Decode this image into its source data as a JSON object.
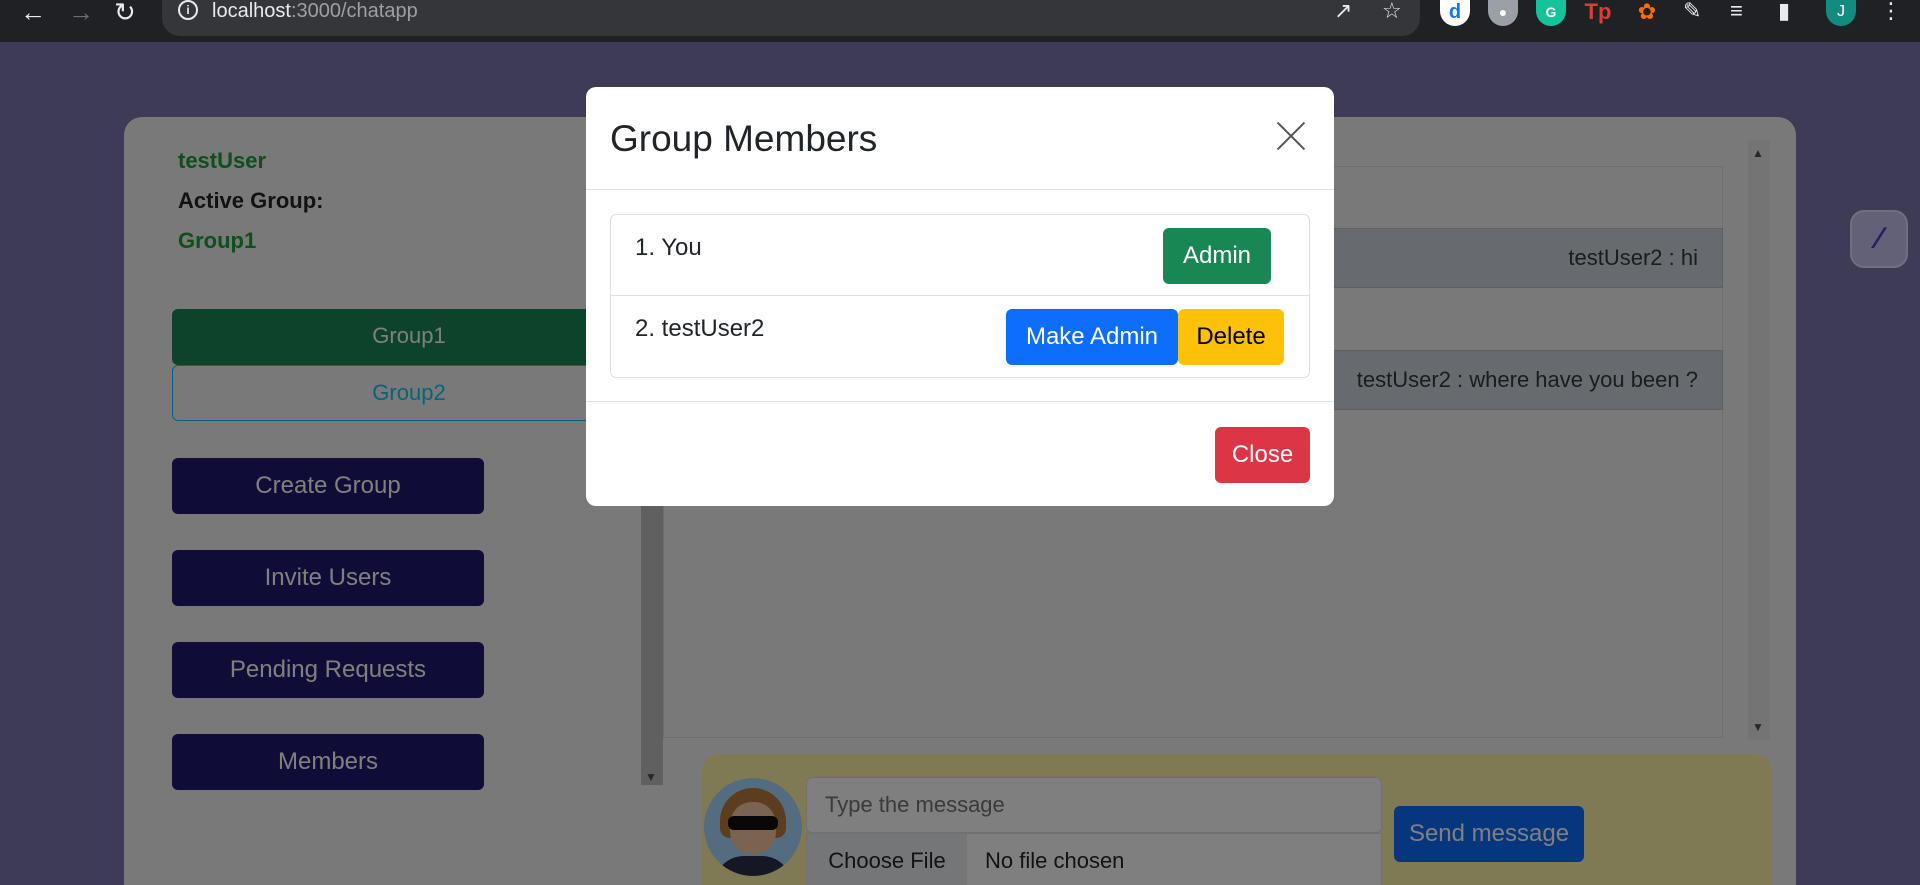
{
  "browser": {
    "url_host": "localhost",
    "url_path": ":3000/chatapp",
    "profile_initial": "J",
    "icons": [
      "back-icon",
      "forward-icon",
      "reload-icon",
      "info-icon",
      "share-icon",
      "star-icon",
      "extensions-icon",
      "reading-list-icon",
      "side-panel-icon",
      "menu-icon"
    ]
  },
  "sidebar": {
    "username": "testUser",
    "active_group_label": "Active Group:",
    "active_group_name": "Group1",
    "groups": [
      {
        "label": "Group1",
        "active": true
      },
      {
        "label": "Group2",
        "active": false
      }
    ],
    "actions": {
      "create": "Create Group",
      "invite": "Invite Users",
      "pending": "Pending Requests",
      "members": "Members"
    }
  },
  "chat": {
    "messages": [
      {
        "text": "testUser2 : hi"
      },
      {
        "text": "testUser2 : where have you been ?"
      }
    ]
  },
  "composer": {
    "placeholder": "Type the message",
    "choose_file": "Choose File",
    "no_file": "No file chosen",
    "send": "Send message"
  },
  "modal": {
    "title": "Group Members",
    "members": [
      {
        "text": "1. You",
        "badge": "Admin"
      },
      {
        "text": "2. testUser2",
        "make_admin": "Make Admin",
        "delete": "Delete"
      }
    ],
    "close": "Close"
  },
  "colors": {
    "page_bg": "#7c76ad",
    "success": "#198754",
    "primary": "#0d6efd",
    "warning": "#ffc107",
    "danger": "#dc3545",
    "navy": "#1f1b6e"
  }
}
